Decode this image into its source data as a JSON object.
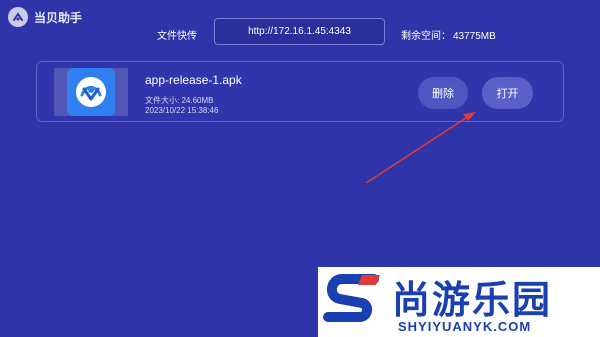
{
  "header": {
    "app_title": "当贝助手",
    "logo_icon": "dangbei-logo-icon"
  },
  "transfer": {
    "label": "文件快传",
    "url": "http://172.16.1.45:4343"
  },
  "storage": {
    "label": "剩余空间：",
    "value": "43775MB"
  },
  "file": {
    "name": "app-release-1.apk",
    "size": "文件大小: 24.60MB",
    "time": "2023/10/22 15:38:46",
    "icon": "app-icon"
  },
  "actions": {
    "delete_label": "删除",
    "open_label": "打开"
  },
  "watermark": {
    "cn_text": "尚游乐园",
    "en_text": "SHYIYUANYK.COM"
  },
  "colors": {
    "background": "#2f34a8",
    "button": "#5056c0",
    "app_icon": "#2f7ff1",
    "arrow": "#e53935",
    "watermark_text": "#1a3fb0"
  }
}
